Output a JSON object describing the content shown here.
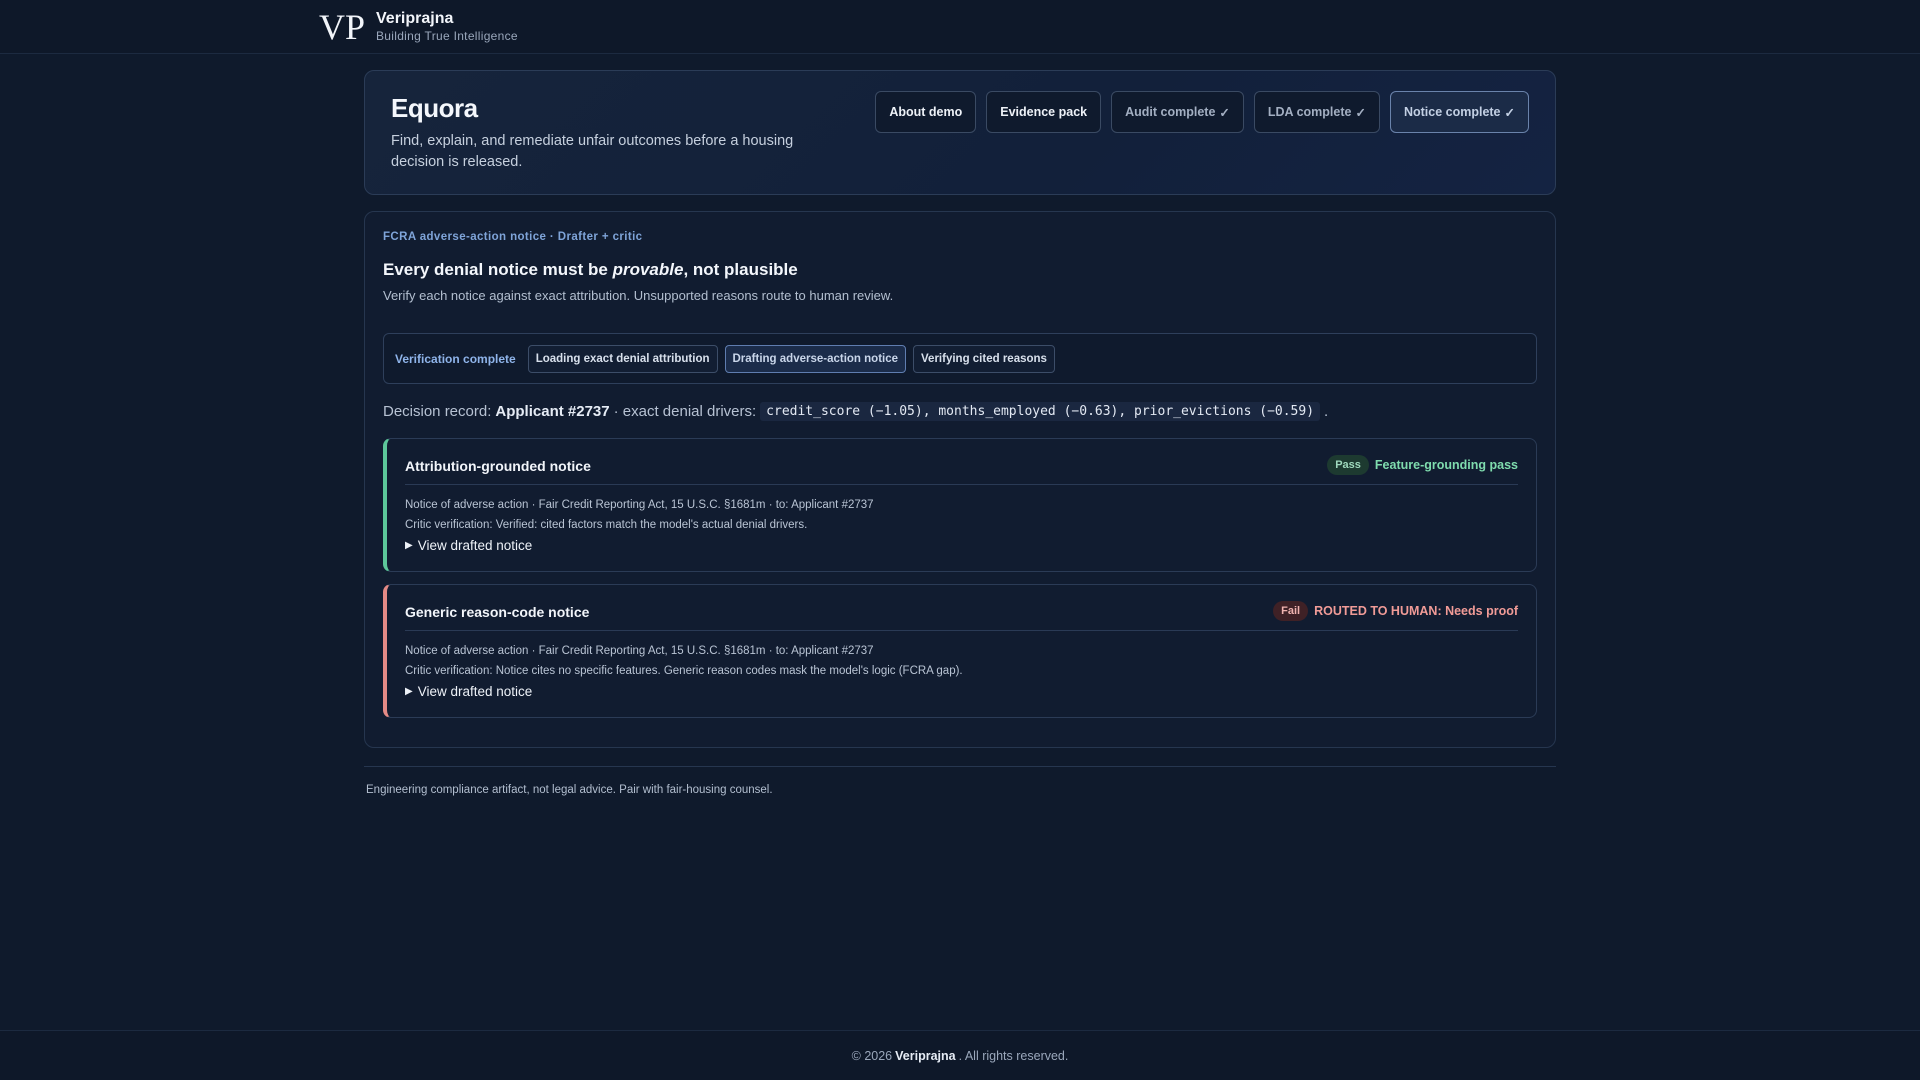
{
  "brand": {
    "logo_text": "VP",
    "name": "Veriprajna",
    "tagline": "Building True Intelligence"
  },
  "hero": {
    "title": "Equora",
    "subtitle": "Find, explain, and remediate unfair outcomes before a housing decision is released.",
    "buttons": [
      {
        "label": "About demo",
        "icon": null
      },
      {
        "label": "Evidence pack",
        "icon": null
      },
      {
        "label": "Audit complete",
        "icon": "check-icon"
      },
      {
        "label": "LDA complete",
        "icon": "check-icon"
      },
      {
        "label": "Notice complete",
        "icon": "check-icon"
      }
    ]
  },
  "panel": {
    "eyebrow": "FCRA adverse-action notice · Drafter + critic",
    "title_prefix": "Every denial notice must be ",
    "title_emphasis": "provable",
    "title_suffix": ", not plausible",
    "subtitle": "Verify each notice against exact attribution. Unsupported reasons route to human review.",
    "steps": {
      "status": "Verification complete",
      "items": [
        "Loading exact denial attribution",
        "Drafting adverse-action notice",
        "Verifying cited reasons"
      ],
      "active_index": 1
    },
    "record": {
      "label": "Decision record:",
      "applicant": "Applicant #2737",
      "drivers_label": "· exact denial drivers:",
      "drivers": "credit_score (−1.05), months_employed (−0.63), prior_evictions (−0.59)",
      "end": "."
    },
    "notices": [
      {
        "title": "Attribution-grounded notice",
        "pill": "Pass",
        "status": "Feature-grounding pass",
        "line1": "Notice of adverse action · Fair Credit Reporting Act, 15 U.S.C. §1681m · to: Applicant #2737",
        "line2": "Critic verification: Verified: cited factors match the model's actual denial drivers.",
        "toggle": "View drafted notice"
      },
      {
        "title": "Generic reason-code notice",
        "pill": "Fail",
        "status": "ROUTED TO HUMAN: Needs proof",
        "line1": "Notice of adverse action · Fair Credit Reporting Act, 15 U.S.C. §1681m · to: Applicant #2737",
        "line2": "Critic verification: Notice cites no specific features. Generic reason codes mask the model's logic (FCRA gap).",
        "toggle": "View drafted notice"
      }
    ]
  },
  "disclaimer": "Engineering compliance artifact, not legal advice. Pair with fair-housing counsel.",
  "footer": {
    "prefix": "© 2026",
    "brand": "Veriprajna",
    "suffix": ". All rights reserved."
  },
  "colors": {
    "background": "#0f1a2c",
    "accent": "#7fa4d9",
    "pass": "#5cc79a",
    "fail": "#e48a86"
  }
}
